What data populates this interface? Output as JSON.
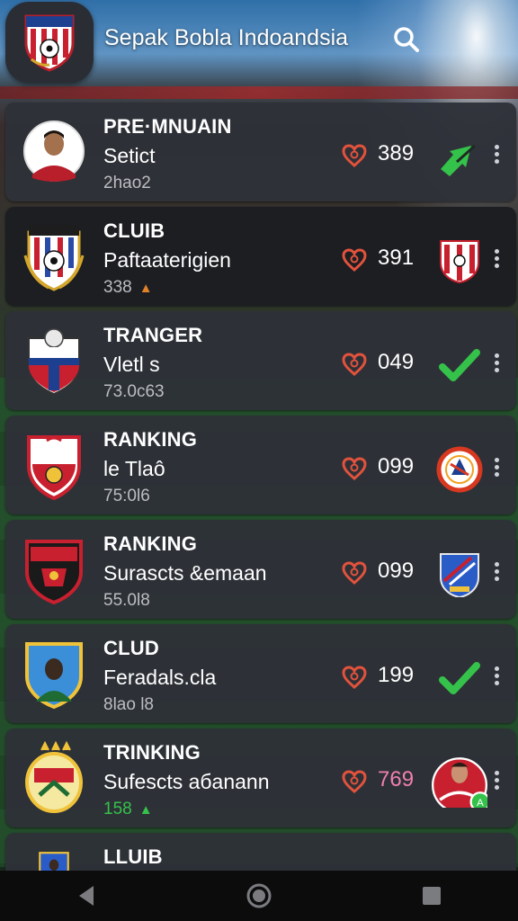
{
  "app": {
    "title": "Sepak Bobla Indoandsia"
  },
  "rows": [
    {
      "category": "PRE·MNUAIN",
      "name": "Setict",
      "sub": "2hao2",
      "trend": "",
      "score": "389",
      "status_icon": "green-arrow-icon",
      "theme": "normal"
    },
    {
      "category": "CLUIB",
      "name": "Paftaaterigien",
      "sub": "338",
      "trend": "▲",
      "trend_color": "#e0822a",
      "score": "391",
      "status_icon": "club-badge-icon",
      "theme": "dark"
    },
    {
      "category": "TRANGER",
      "name": "Vletl s",
      "sub": "73.0c63",
      "trend": "",
      "score": "049",
      "status_icon": "checkmark-icon",
      "theme": "normal"
    },
    {
      "category": "RANKING",
      "name": "le Tlaô",
      "sub": "75:0l6",
      "trend": "",
      "score": "099",
      "status_icon": "club-badge-icon",
      "theme": "normal"
    },
    {
      "category": "RANKING",
      "name": "Surascts &emaan",
      "sub": "55.0l8",
      "trend": "",
      "score": "099",
      "status_icon": "club-badge-icon",
      "theme": "normal"
    },
    {
      "category": "CLUD",
      "name": "Feradals.cla",
      "sub": "8lao l8",
      "trend": "",
      "score": "199",
      "status_icon": "checkmark-icon",
      "theme": "normal"
    },
    {
      "category": "TRINKING",
      "name": "Sufescts aбanann",
      "sub": "158",
      "trend": "▲",
      "trend_color": "#35c24a",
      "sub_color": "#35c24a",
      "score": "769",
      "score_color": "#f07fb0",
      "status_icon": "player-avatar-icon",
      "theme": "normal"
    },
    {
      "category": "LLUIB",
      "name": "",
      "sub": "",
      "trend": "",
      "score": "",
      "status_icon": "",
      "theme": "normal"
    }
  ],
  "colors": {
    "accent_green": "#35c24a",
    "heart_red": "#e2523c",
    "card_bg": "#2e3138",
    "pink_score": "#f07fb0"
  },
  "navbar": {
    "back_icon": "back-triangle-icon",
    "home_icon": "home-circle-icon",
    "recents_icon": "recents-square-icon"
  }
}
